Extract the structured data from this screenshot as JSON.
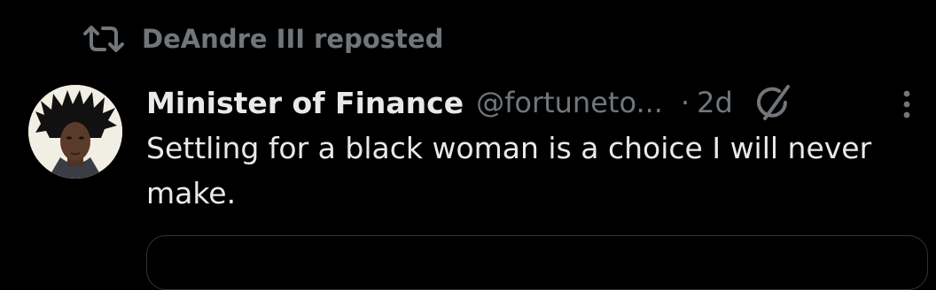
{
  "repost": {
    "icon": "repost-icon",
    "text": "DeAndre III reposted"
  },
  "post": {
    "display_name": "Minister of Finance",
    "handle": "@fortuneto...",
    "separator": "·",
    "timestamp": "2d",
    "avatar_icon": "avatar",
    "grok_icon": "grok-icon",
    "more_icon": "more-options-icon",
    "text": "Settling for a black woman is a choice I will never make."
  },
  "colors": {
    "background": "#000000",
    "primary_text": "#e7e9ea",
    "secondary_text": "#71767b",
    "border": "#2f3336"
  }
}
